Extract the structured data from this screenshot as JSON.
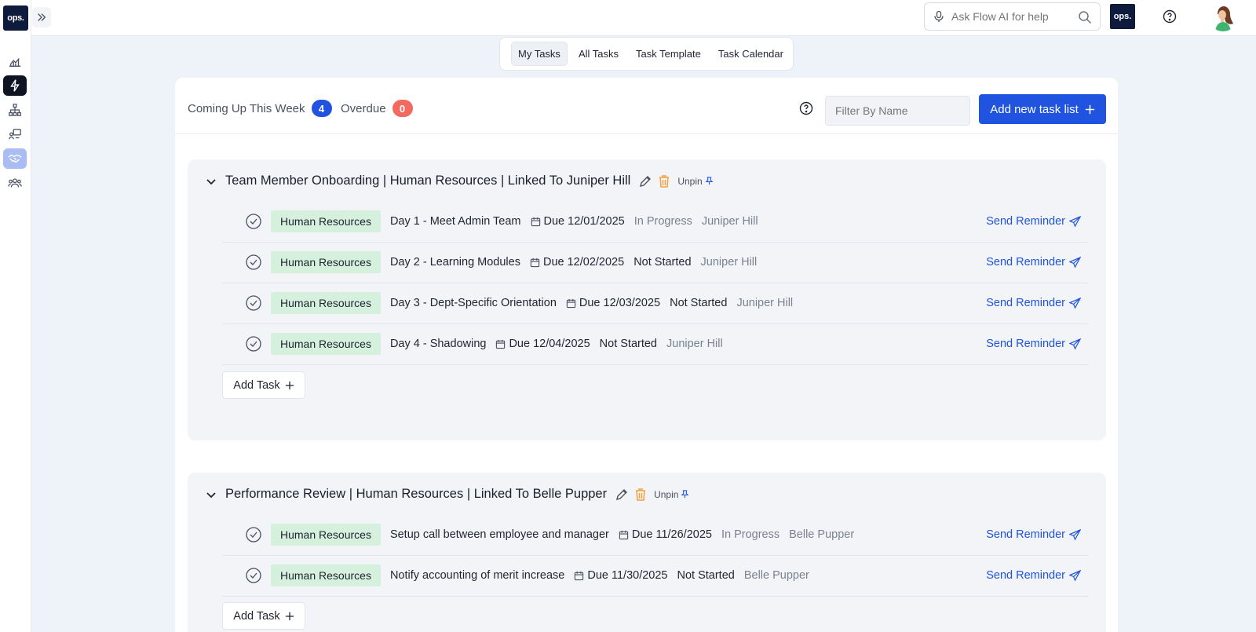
{
  "app": {
    "logo_text": "ops.",
    "mini_logo_text": "ops."
  },
  "search": {
    "placeholder": "Ask Flow AI for help"
  },
  "tabs": [
    {
      "label": "My Tasks",
      "active": true
    },
    {
      "label": "All Tasks",
      "active": false
    },
    {
      "label": "Task Template",
      "active": false
    },
    {
      "label": "Task Calendar",
      "active": false
    }
  ],
  "header": {
    "coming_up_label": "Coming Up This Week",
    "coming_up_count": "4",
    "overdue_label": "Overdue",
    "overdue_count": "0",
    "filter_placeholder": "Filter By Name",
    "add_list_label": "Add new task list",
    "add_list_icon": "plus-icon"
  },
  "groups": [
    {
      "title": "Team Member Onboarding | Human Resources | Linked To Juniper Hill",
      "unpin_label": "Unpin",
      "add_task_label": "Add Task",
      "tasks": [
        {
          "dept": "Human Resources",
          "name": "Day 1 - Meet Admin Team",
          "due": "Due 12/01/2025",
          "status": "In Progress",
          "person": "Juniper Hill",
          "reminder": "Send Reminder"
        },
        {
          "dept": "Human Resources",
          "name": "Day 2 - Learning Modules",
          "due": "Due 12/02/2025",
          "status": "Not Started",
          "person": "Juniper Hill",
          "reminder": "Send Reminder"
        },
        {
          "dept": "Human Resources",
          "name": "Day 3 - Dept-Specific Orientation",
          "due": "Due 12/03/2025",
          "status": "Not Started",
          "person": "Juniper Hill",
          "reminder": "Send Reminder"
        },
        {
          "dept": "Human Resources",
          "name": "Day 4 - Shadowing",
          "due": "Due 12/04/2025",
          "status": "Not Started",
          "person": "Juniper Hill",
          "reminder": "Send Reminder"
        }
      ]
    },
    {
      "title": "Performance Review | Human Resources | Linked To Belle Pupper",
      "unpin_label": "Unpin",
      "add_task_label": "Add Task",
      "tasks": [
        {
          "dept": "Human Resources",
          "name": "Setup call between employee and manager",
          "due": "Due 11/26/2025",
          "status": "In Progress",
          "person": "Belle Pupper",
          "reminder": "Send Reminder"
        },
        {
          "dept": "Human Resources",
          "name": "Notify accounting of merit increase",
          "due": "Due 11/30/2025",
          "status": "Not Started",
          "person": "Belle Pupper",
          "reminder": "Send Reminder"
        }
      ]
    }
  ],
  "colors": {
    "accent": "#1f53e0",
    "overdue": "#f26a5f",
    "dept_tag": "#d5f0dd",
    "sidebar_active": "#0e1421"
  }
}
